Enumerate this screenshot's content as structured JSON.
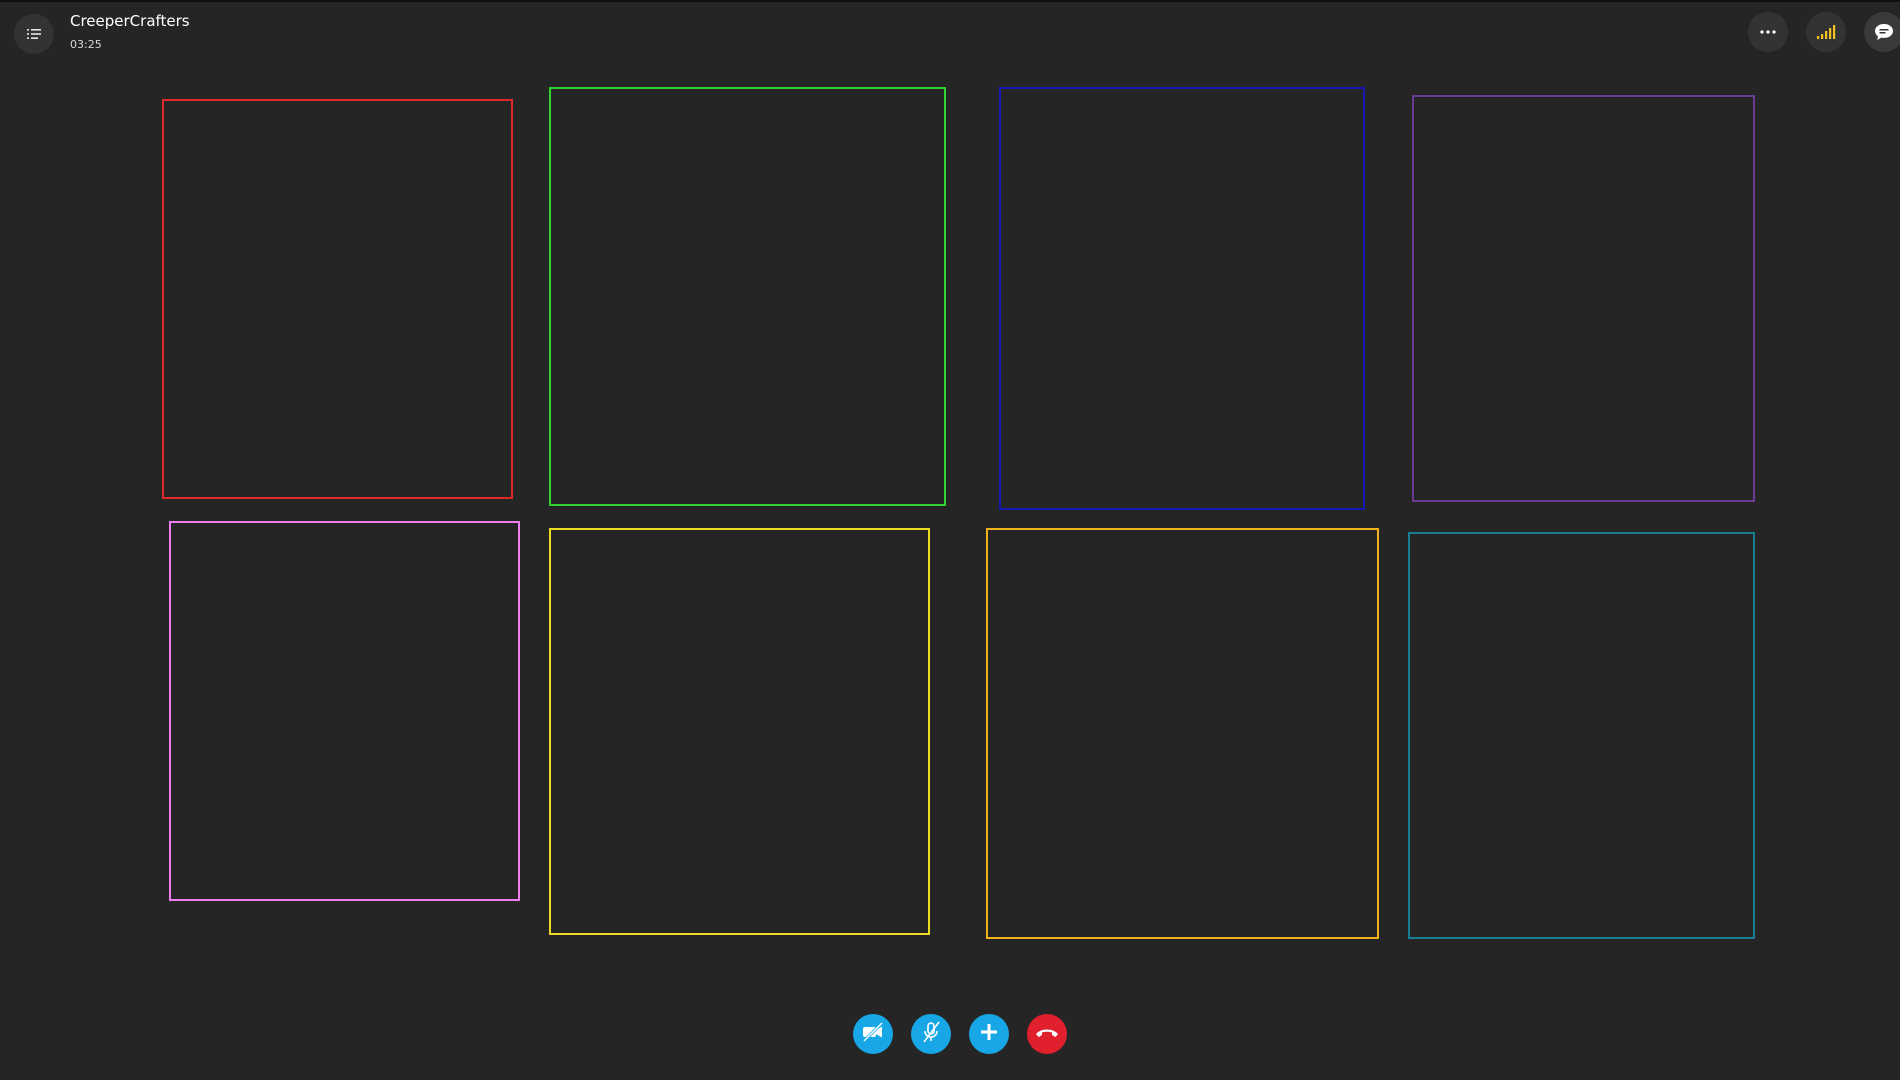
{
  "call": {
    "title": "CreeperCrafters",
    "timer": "03:25"
  },
  "header": {
    "menu_icon": "list-menu-icon",
    "more_icon": "more-options-icon",
    "signal_icon": "call-quality-signal-icon",
    "chat_icon": "chat-bubble-icon"
  },
  "participants": [
    {
      "color": "#e02a2a"
    },
    {
      "color": "#2fd22f"
    },
    {
      "color": "#1818b4"
    },
    {
      "color": "#6b3a92"
    },
    {
      "color": "#ef7ef0"
    },
    {
      "color": "#eedb23"
    },
    {
      "color": "#f2b21e"
    },
    {
      "color": "#177f93"
    }
  ],
  "controls": {
    "video": {
      "icon": "video-off-icon",
      "color": "#17a6e6"
    },
    "mic": {
      "icon": "mic-off-icon",
      "color": "#17a6e6"
    },
    "add": {
      "icon": "plus-icon",
      "color": "#17a6e6"
    },
    "hangup": {
      "icon": "hang-up-icon",
      "color": "#e0202d"
    }
  },
  "colors": {
    "background": "#252525",
    "signal_accent": "#f2c21e"
  }
}
